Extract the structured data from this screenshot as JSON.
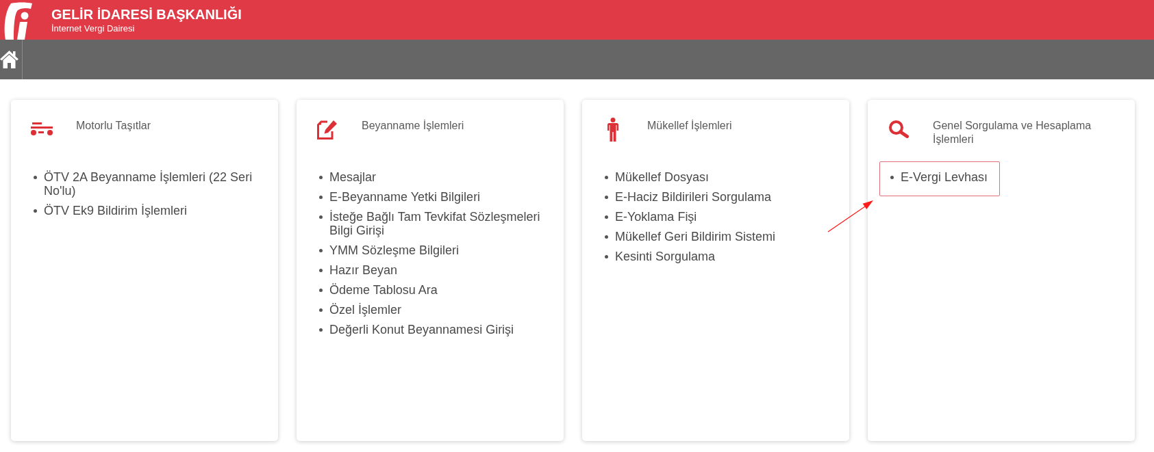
{
  "header": {
    "title": "GELİR İDARESİ BAŞKANLIĞI",
    "subtitle": "İnternet Vergi Dairesi"
  },
  "cards": [
    {
      "kind": "vehicle",
      "title": "Motorlu Taşıtlar",
      "items": [
        {
          "label": "ÖTV 2A Beyanname İşlemleri (22 Seri No'lu)",
          "highlighted": false
        },
        {
          "label": "ÖTV Ek9 Bildirim İşlemleri",
          "highlighted": false
        }
      ]
    },
    {
      "kind": "document",
      "title": "Beyanname İşlemleri",
      "items": [
        {
          "label": "Mesajlar",
          "highlighted": false
        },
        {
          "label": "E-Beyanname Yetki Bilgileri",
          "highlighted": false
        },
        {
          "label": "İsteğe Bağlı Tam Tevkifat Sözleşmeleri Bilgi Girişi",
          "highlighted": false
        },
        {
          "label": "YMM Sözleşme Bilgileri",
          "highlighted": false
        },
        {
          "label": "Hazır Beyan",
          "highlighted": false
        },
        {
          "label": "Ödeme Tablosu Ara",
          "highlighted": false
        },
        {
          "label": "Özel İşlemler",
          "highlighted": false
        },
        {
          "label": "Değerli Konut Beyannamesi Girişi",
          "highlighted": false
        }
      ]
    },
    {
      "kind": "person",
      "title": "Mükellef İşlemleri",
      "items": [
        {
          "label": "Mükellef Dosyası",
          "highlighted": false
        },
        {
          "label": "E-Haciz Bildirileri Sorgulama",
          "highlighted": false
        },
        {
          "label": "E-Yoklama Fişi",
          "highlighted": false
        },
        {
          "label": "Mükellef Geri Bildirim Sistemi",
          "highlighted": false
        },
        {
          "label": "Kesinti Sorgulama",
          "highlighted": false
        }
      ]
    },
    {
      "kind": "search",
      "title": "Genel Sorgulama ve Hesaplama İşlemleri",
      "items": [
        {
          "label": "E-Vergi Levhası",
          "highlighted": true
        }
      ]
    }
  ]
}
